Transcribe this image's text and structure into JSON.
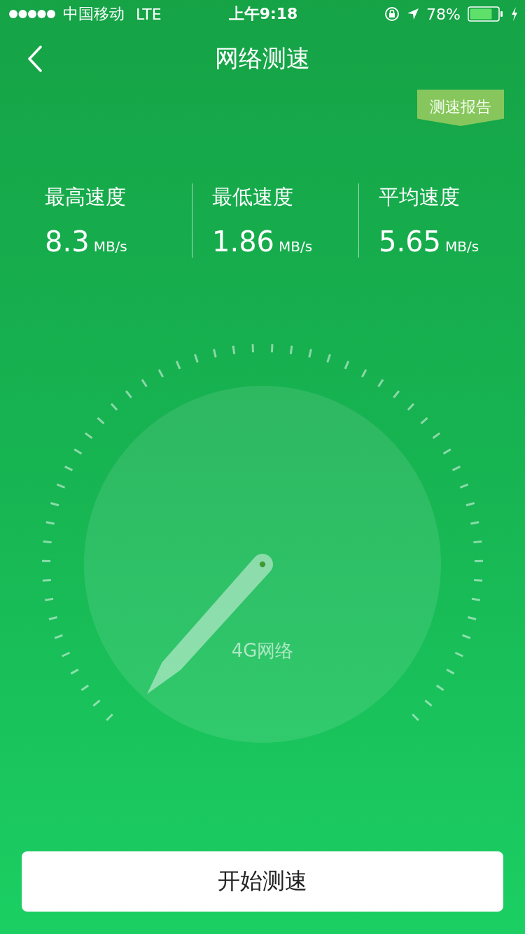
{
  "status_bar": {
    "carrier": "中国移动",
    "network": "LTE",
    "time": "上午9:18",
    "battery": "78%"
  },
  "nav": {
    "title": "网络测速"
  },
  "report_tag": "测速报告",
  "stats": [
    {
      "label": "最高速度",
      "value": "8.3",
      "unit": "MB/s"
    },
    {
      "label": "最低速度",
      "value": "1.86",
      "unit": "MB/s"
    },
    {
      "label": "平均速度",
      "value": "5.65",
      "unit": "MB/s"
    }
  ],
  "gauge": {
    "network_label": "4G网络"
  },
  "start_button": "开始测速"
}
